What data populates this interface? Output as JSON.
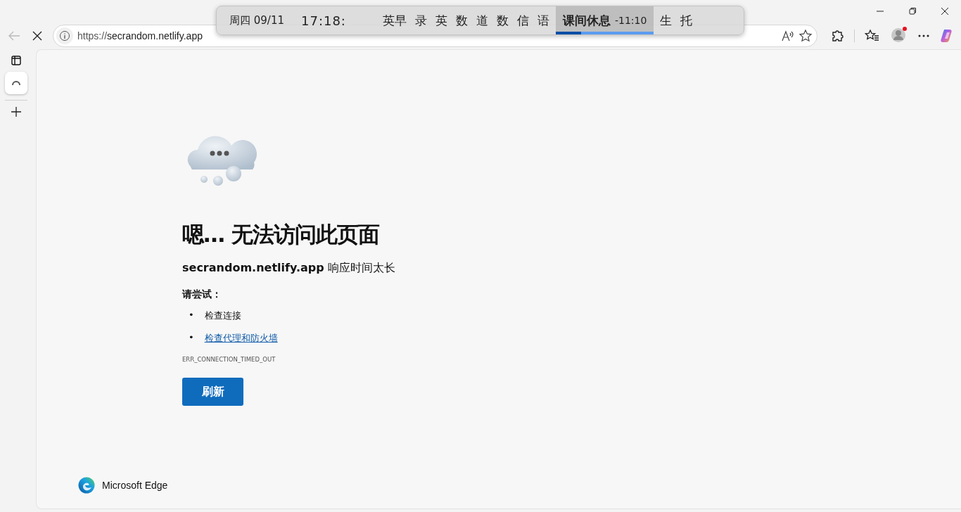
{
  "navigation": {
    "back_disabled": true,
    "loading": true
  },
  "address_bar": {
    "url": "https://secrandom.netlify.app"
  },
  "profile": {
    "notification": true
  },
  "schedule_bar": {
    "date": "周四 09/11",
    "time": "17:18:",
    "items": [
      {
        "label": "英早",
        "selected": false
      },
      {
        "label": "录",
        "selected": false
      },
      {
        "label": "英",
        "selected": false
      },
      {
        "label": "数",
        "selected": false
      },
      {
        "label": "道",
        "selected": false
      },
      {
        "label": "数",
        "selected": false
      },
      {
        "label": "信",
        "selected": false
      },
      {
        "label": "语",
        "selected": false
      },
      {
        "label": "课间休息",
        "selected": true,
        "countdown": "-11:10",
        "level": 0.26
      },
      {
        "label": "生",
        "selected": false
      },
      {
        "label": "托",
        "selected": false
      }
    ]
  },
  "page": {
    "heading": "嗯… 无法访问此页面",
    "subheading": "**secrandom.netlify.app** 响应时间太长",
    "try_label": "请尝试：",
    "suggestions": [
      {
        "kind": "text",
        "marker": "•",
        "text": "检查连接"
      },
      {
        "kind": "link",
        "marker": "•",
        "text": "检查代理和防火墙"
      }
    ],
    "error_code": "ERR_CONNECTION_TIMED_OUT",
    "refresh_button": "刷新"
  },
  "footer": {
    "brand": "Microsoft Edge"
  }
}
